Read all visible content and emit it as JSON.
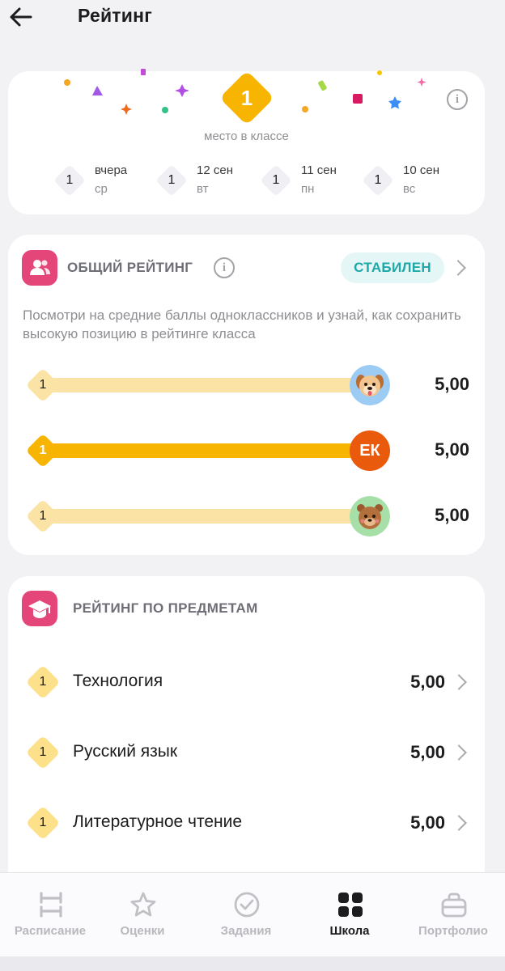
{
  "header": {
    "title": "Рейтинг"
  },
  "top_card": {
    "place": "1",
    "caption": "место в классе",
    "days": [
      {
        "place": "1",
        "date": "вчера",
        "weekday": "ср"
      },
      {
        "place": "1",
        "date": "12 сен",
        "weekday": "вт"
      },
      {
        "place": "1",
        "date": "11 сен",
        "weekday": "пн"
      },
      {
        "place": "1",
        "date": "10 сен",
        "weekday": "вс"
      }
    ]
  },
  "general": {
    "title": "ОБЩИЙ РЕЙТИНГ",
    "status": "СТАБИЛЕН",
    "description": "Посмотри на средние баллы одноклассников и узнай, как сохранить высокую позицию в рейтинге класса",
    "rows": [
      {
        "place": "1",
        "avatar": "dog-avatar",
        "score": "5,00",
        "is_me": false
      },
      {
        "place": "1",
        "avatar": "ЕК",
        "score": "5,00",
        "is_me": true
      },
      {
        "place": "1",
        "avatar": "bear-avatar",
        "score": "5,00",
        "is_me": false
      }
    ]
  },
  "subjects": {
    "title": "РЕЙТИНГ ПО ПРЕДМЕТАМ",
    "rows": [
      {
        "place": "1",
        "name": "Технология",
        "score": "5,00"
      },
      {
        "place": "1",
        "name": "Русский язык",
        "score": "5,00"
      },
      {
        "place": "1",
        "name": "Литературное чтение",
        "score": "5,00"
      }
    ]
  },
  "tabbar": {
    "tabs": [
      {
        "label": "Расписание",
        "icon": "schedule-icon",
        "active": false
      },
      {
        "label": "Оценки",
        "icon": "star-icon",
        "active": false
      },
      {
        "label": "Задания",
        "icon": "check-circle-icon",
        "active": false
      },
      {
        "label": "Школа",
        "icon": "grid-icon",
        "active": true
      },
      {
        "label": "Портфолио",
        "icon": "briefcase-icon",
        "active": false
      }
    ]
  },
  "colors": {
    "accent_gold": "#f7b400",
    "light_gold": "#fbe3a6",
    "section_icon_pink": "#e5467a",
    "status_teal": "#1fa8a8",
    "avatar_orange": "#ea5a0c"
  }
}
